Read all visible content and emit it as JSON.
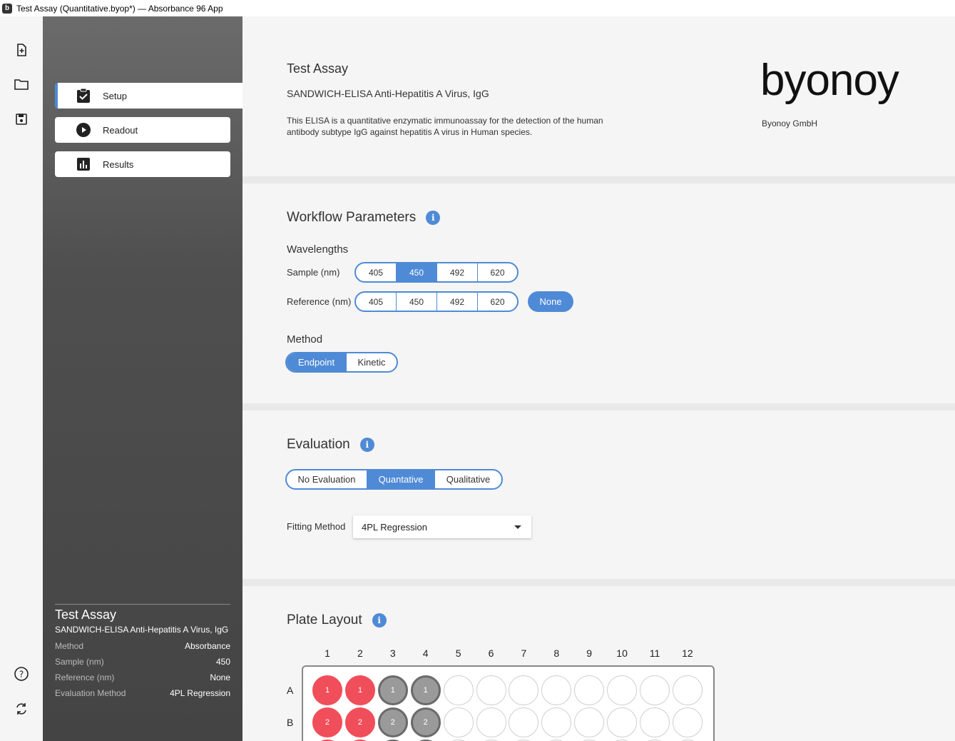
{
  "window": {
    "title": "Test Assay (Quantitative.byop*) — Absorbance 96 App",
    "logo_letter": "b"
  },
  "iconbar": {
    "items": [
      "new-file-icon",
      "open-folder-icon",
      "save-icon",
      "help-icon",
      "sync-icon"
    ]
  },
  "nav": {
    "items": [
      {
        "label": "Setup",
        "icon": "clipboard-check-icon",
        "active": true
      },
      {
        "label": "Readout",
        "icon": "play-icon",
        "active": false
      },
      {
        "label": "Results",
        "icon": "bar-chart-icon",
        "active": false
      }
    ]
  },
  "summary": {
    "title": "Test Assay",
    "subtitle": "SANDWICH-ELISA Anti-Hepatitis A Virus, IgG",
    "rows": [
      {
        "key": "Method",
        "value": "Absorbance"
      },
      {
        "key": "Sample (nm)",
        "value": "450"
      },
      {
        "key": "Reference (nm)",
        "value": "None"
      },
      {
        "key": "Evaluation Method",
        "value": "4PL Regression"
      }
    ]
  },
  "assay": {
    "title": "Test Assay",
    "subtitle": "SANDWICH-ELISA Anti-Hepatitis A Virus, IgG",
    "description_line1": "This ELISA is a quantitative enzymatic immunoassay for the detection of the human",
    "description_line2": "antibody subtype IgG against hepatitis A virus in Human species.",
    "brand_logo": "byonoy",
    "company": "Byonoy GmbH"
  },
  "workflow": {
    "heading": "Workflow Parameters",
    "info": "i",
    "wavelengths_label": "Wavelengths",
    "sample_label": "Sample (nm)",
    "reference_label": "Reference (nm)",
    "wavelength_options": [
      "405",
      "450",
      "492",
      "620"
    ],
    "sample_selected": "450",
    "reference_selected": "None",
    "none_label": "None",
    "method_label": "Method",
    "method_options": [
      "Endpoint",
      "Kinetic"
    ],
    "method_selected": "Endpoint"
  },
  "evaluation": {
    "heading": "Evaluation",
    "info": "i",
    "options": [
      "No Evaluation",
      "Quantative",
      "Qualitative"
    ],
    "selected": "Quantative",
    "fitting_label": "Fitting Method",
    "fitting_value": "4PL Regression"
  },
  "plate": {
    "heading": "Plate Layout",
    "info": "i",
    "columns": [
      "1",
      "2",
      "3",
      "4",
      "5",
      "6",
      "7",
      "8",
      "9",
      "10",
      "11",
      "12"
    ],
    "rows": [
      {
        "label": "A",
        "wells": [
          {
            "t": "1",
            "type": "red"
          },
          {
            "t": "1",
            "type": "red"
          },
          {
            "t": "1",
            "type": "grey"
          },
          {
            "t": "1",
            "type": "grey"
          },
          {
            "t": "",
            "type": "empty"
          },
          {
            "t": "",
            "type": "empty"
          },
          {
            "t": "",
            "type": "empty"
          },
          {
            "t": "",
            "type": "empty"
          },
          {
            "t": "",
            "type": "empty"
          },
          {
            "t": "",
            "type": "empty"
          },
          {
            "t": "",
            "type": "empty"
          },
          {
            "t": "",
            "type": "empty"
          }
        ]
      },
      {
        "label": "B",
        "wells": [
          {
            "t": "2",
            "type": "red"
          },
          {
            "t": "2",
            "type": "red"
          },
          {
            "t": "2",
            "type": "grey"
          },
          {
            "t": "2",
            "type": "grey"
          },
          {
            "t": "",
            "type": "empty"
          },
          {
            "t": "",
            "type": "empty"
          },
          {
            "t": "",
            "type": "empty"
          },
          {
            "t": "",
            "type": "empty"
          },
          {
            "t": "",
            "type": "empty"
          },
          {
            "t": "",
            "type": "empty"
          },
          {
            "t": "",
            "type": "empty"
          },
          {
            "t": "",
            "type": "empty"
          }
        ]
      },
      {
        "label": "",
        "wells": [
          {
            "t": "",
            "type": "red"
          },
          {
            "t": "",
            "type": "red"
          },
          {
            "t": "",
            "type": "grey"
          },
          {
            "t": "",
            "type": "grey"
          },
          {
            "t": "",
            "type": "empty"
          },
          {
            "t": "",
            "type": "empty"
          },
          {
            "t": "",
            "type": "empty"
          },
          {
            "t": "",
            "type": "empty"
          },
          {
            "t": "",
            "type": "empty"
          },
          {
            "t": "",
            "type": "empty"
          },
          {
            "t": "",
            "type": "empty"
          },
          {
            "t": "",
            "type": "empty"
          }
        ]
      }
    ]
  },
  "colors": {
    "accent": "#4f8ad6",
    "well_red": "#f04e5a",
    "well_grey": "#9a9a9a"
  }
}
